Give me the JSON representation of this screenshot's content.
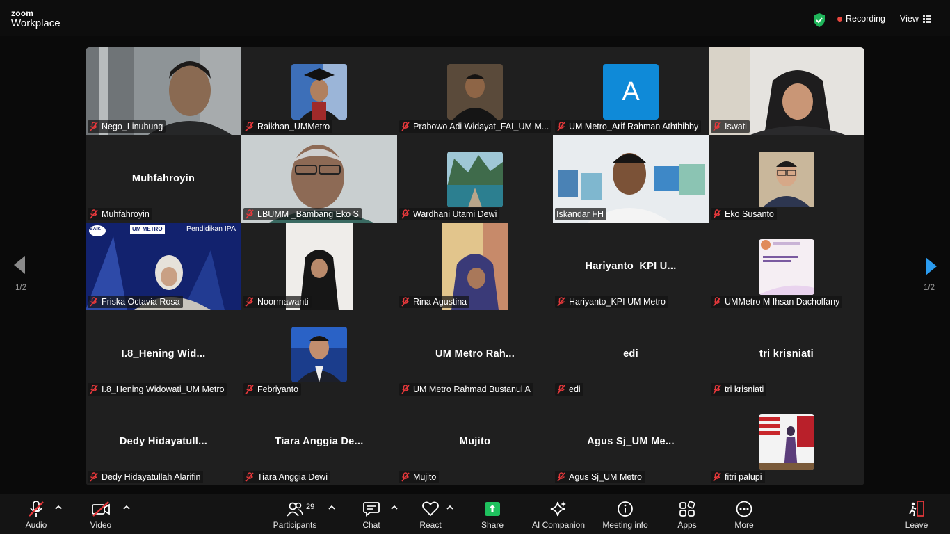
{
  "app": {
    "brand_top": "zoom",
    "brand_bottom": "Workplace"
  },
  "topbar": {
    "recording_label": "Recording",
    "view_label": "View"
  },
  "participants": [
    {
      "name": "Nego_Linuhung",
      "display": ""
    },
    {
      "name": "Raikhan_UMMetro",
      "display": ""
    },
    {
      "name": "Prabowo Adi Widayat_FAI_UM M...",
      "display": ""
    },
    {
      "name": "UM Metro_Arif Rahman Aththibby",
      "display": "A"
    },
    {
      "name": "Iswati",
      "display": ""
    },
    {
      "name": "Muhfahroyin",
      "display": "Muhfahroyin"
    },
    {
      "name": "LBUMM _Bambang Eko S",
      "display": ""
    },
    {
      "name": "Wardhani Utami Dewi",
      "display": ""
    },
    {
      "name": "Iskandar FH",
      "display": ""
    },
    {
      "name": "Eko Susanto",
      "display": ""
    },
    {
      "name": "Friska Octavia Rosa",
      "display": ""
    },
    {
      "name": "Noormawanti",
      "display": ""
    },
    {
      "name": "Rina Agustina",
      "display": ""
    },
    {
      "name": "Hariyanto_KPI UM Metro",
      "display": "Hariyanto_KPI  U..."
    },
    {
      "name": "UMMetro M Ihsan Dacholfany",
      "display": ""
    },
    {
      "name": "I.8_Hening Widowati_UM Metro",
      "display": "I.8_Hening  Wid..."
    },
    {
      "name": "Febriyanto",
      "display": ""
    },
    {
      "name": "UM Metro Rahmad Bustanul A",
      "display": "UM  Metro  Rah..."
    },
    {
      "name": "edi",
      "display": "edi"
    },
    {
      "name": "tri krisniati",
      "display": "tri krisniati"
    },
    {
      "name": "Dedy Hidayatullah Alarifin",
      "display": "Dedy  Hidayatull..."
    },
    {
      "name": "Tiara Anggia Dewi",
      "display": "Tiara  Anggia  De..."
    },
    {
      "name": "Mujito",
      "display": "Mujito"
    },
    {
      "name": "Agus Sj_UM Metro",
      "display": "Agus  Sj_UM  Me..."
    },
    {
      "name": "fitri palupi",
      "display": ""
    }
  ],
  "banner": {
    "left_logo": "BAIK",
    "mid_logo": "UM METRO",
    "program": "Pendidikan IPA"
  },
  "paging": {
    "left": "1/2",
    "right": "1/2"
  },
  "toolbar": {
    "audio": "Audio",
    "video": "Video",
    "participants": "Participants",
    "participants_count": "29",
    "chat": "Chat",
    "react": "React",
    "share": "Share",
    "ai_companion": "AI Companion",
    "meeting_info": "Meeting info",
    "apps": "Apps",
    "more": "More",
    "leave": "Leave"
  },
  "colors": {
    "active_speaker": "#3fd46f",
    "share_green": "#1fc15e",
    "record_red": "#e8473e",
    "avatar_blue": "#0f8ad8",
    "muted_red": "#e5383b"
  }
}
